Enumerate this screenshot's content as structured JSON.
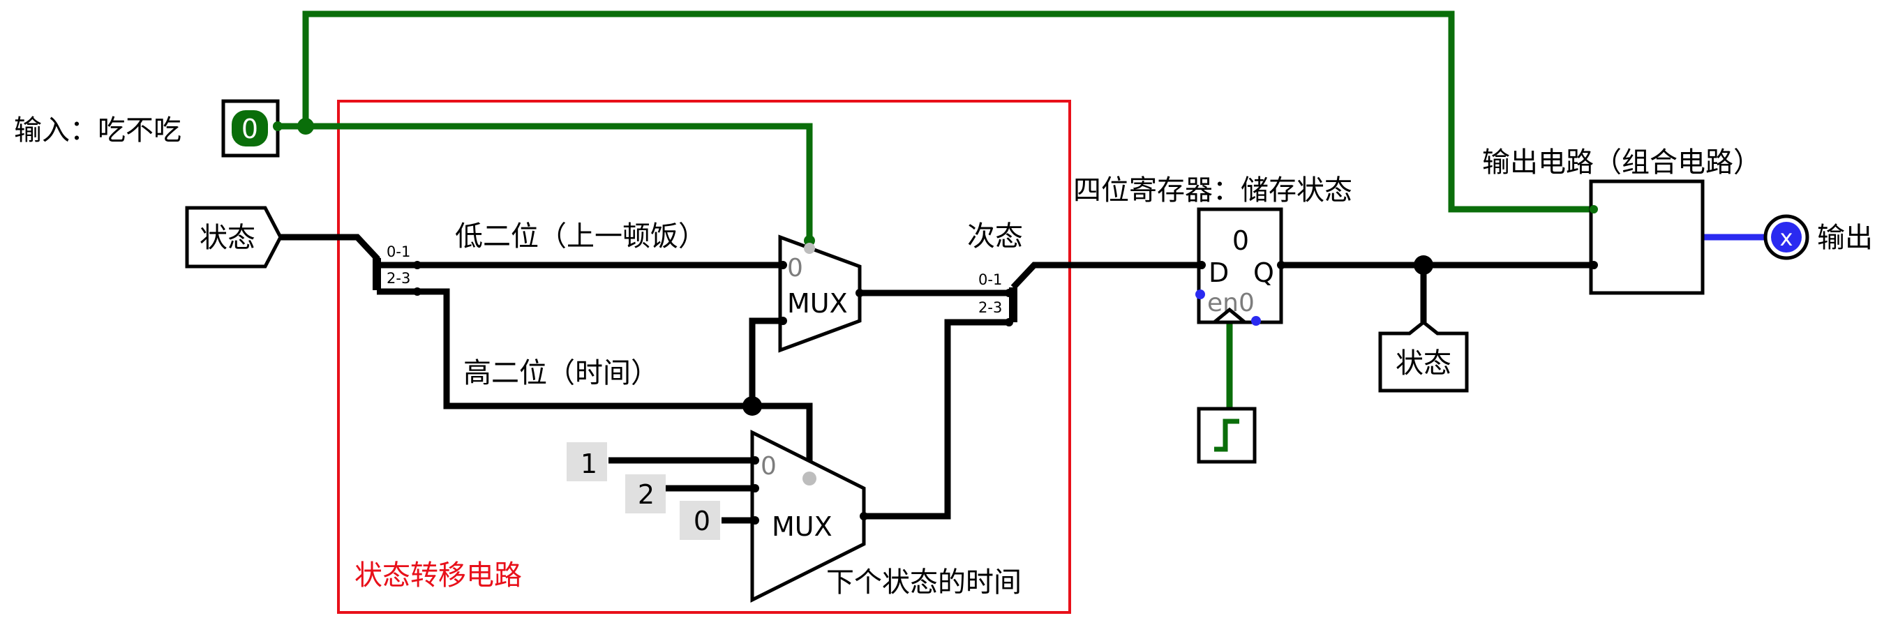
{
  "input": {
    "label": "输入：吃不吃",
    "value": "0"
  },
  "state_in": {
    "label": "状态"
  },
  "state_out": {
    "label": "状态"
  },
  "splitter_in": {
    "low": "0-1",
    "high": "2-3"
  },
  "splitter_out": {
    "low": "0-1",
    "high": "2-3"
  },
  "label_low_bits": "低二位（上一顿饭）",
  "label_high_bits": "高二位（时间）",
  "label_next_state": "次态",
  "label_next_time": "下个状态的时间",
  "transition_box_label": "状态转移电路",
  "mux1": {
    "label": "MUX",
    "select_bit": "0"
  },
  "mux2": {
    "label": "MUX",
    "select_bit": "0"
  },
  "constants": [
    "1",
    "2",
    "0"
  ],
  "register": {
    "title": "四位寄存器：储存状态",
    "value": "0",
    "d": "D",
    "q": "Q",
    "en": "en0"
  },
  "output_circuit": {
    "title": "输出电路（组合电路）"
  },
  "output": {
    "label": "输出",
    "value": "x"
  },
  "colors": {
    "wire_active": "#0a6e0a",
    "wire_error": "#2a2af0",
    "frame": "#e8101a",
    "label_red": "#e8101a"
  }
}
